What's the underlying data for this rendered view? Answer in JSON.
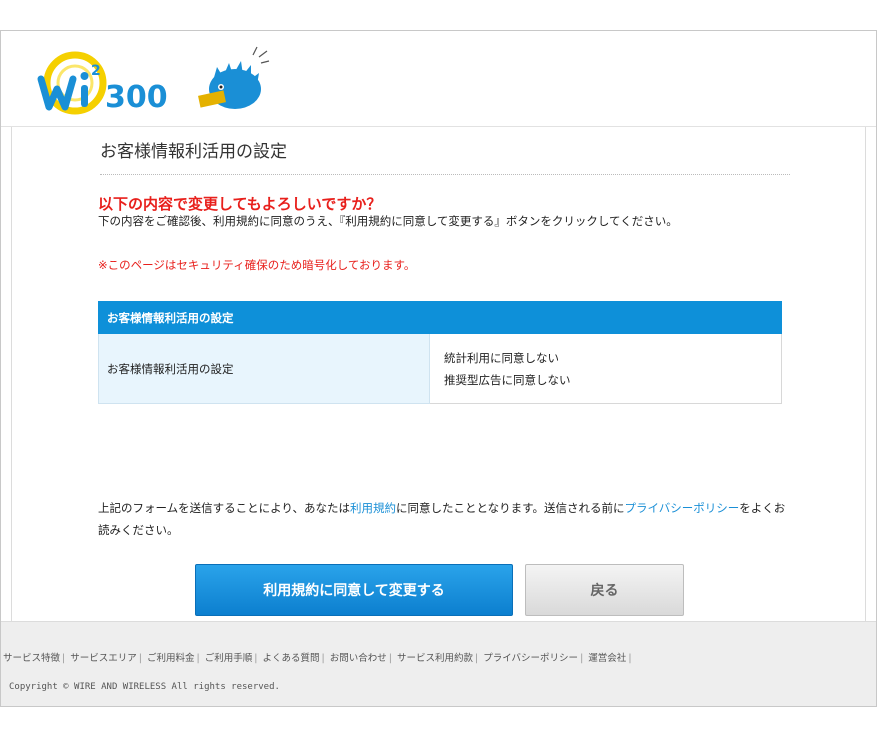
{
  "header": {
    "logo_text": "Wi²300",
    "logo_icon": "hedgehog-mascot-icon"
  },
  "main": {
    "page_title": "お客様情報利活用の設定",
    "confirm_heading": "以下の内容で変更してもよろしいですか？",
    "instruction": "下の内容をご確認後、利用規約に同意のうえ、『利用規約に同意して変更する』ボタンをクリックしてください。",
    "security_note": "※このページはセキュリティ確保のため暗号化しております。",
    "table": {
      "header": "お客様情報利活用の設定",
      "row_label": "お客様情報利活用の設定",
      "values": [
        "統計利用に同意しない",
        "推奨型広告に同意しない"
      ]
    },
    "terms": {
      "text1": "上記のフォームを送信することにより、あなたは",
      "terms_link": "利用規約",
      "text2": "に同意したこととなります。送信される前に",
      "privacy_link": "プライバシーポリシー",
      "text3": "をよくお読みください。"
    },
    "buttons": {
      "agree_label": "利用規約に同意して変更する",
      "back_label": "戻る"
    }
  },
  "footer": {
    "links": [
      "サービス特徴",
      "サービスエリア",
      "ご利用料金",
      "ご利用手順",
      "よくある質問",
      "お問い合わせ",
      "サービス利用約款",
      "プライバシーポリシー",
      "運営会社"
    ],
    "copyright": "Copyright © WIRE AND WIRELESS All rights reserved."
  },
  "colors": {
    "accent_blue": "#0e90d9",
    "alert_red": "#e8201c",
    "link_blue": "#1a8fd6"
  }
}
